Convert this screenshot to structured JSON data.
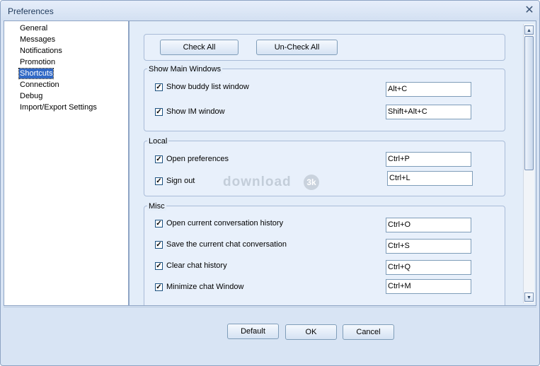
{
  "window": {
    "title": "Preferences"
  },
  "nav": {
    "items": [
      {
        "label": "General"
      },
      {
        "label": "Messages"
      },
      {
        "label": "Notifications"
      },
      {
        "label": "Promotion"
      },
      {
        "label": "Shortcuts",
        "selected": true
      },
      {
        "label": "Connection"
      },
      {
        "label": "Debug"
      },
      {
        "label": "Import/Export Settings"
      }
    ]
  },
  "toolbar": {
    "check_all": "Check All",
    "uncheck_all": "Un-Check All"
  },
  "groups": {
    "main_windows": {
      "title": "Show Main Windows",
      "rows": [
        {
          "label": "Show buddy list window",
          "shortcut": "Alt+C",
          "checked": true
        },
        {
          "label": "Show IM window",
          "shortcut": "Shift+Alt+C",
          "checked": true
        }
      ]
    },
    "local": {
      "title": "Local",
      "rows": [
        {
          "label": "Open preferences",
          "shortcut": "Ctrl+P",
          "checked": true
        },
        {
          "label": "Sign out",
          "shortcut": "Ctrl+L",
          "checked": true
        }
      ]
    },
    "misc": {
      "title": "Misc",
      "rows": [
        {
          "label": "Open current conversation history",
          "shortcut": "Ctrl+O",
          "checked": true
        },
        {
          "label": "Save the current chat conversation",
          "shortcut": "Ctrl+S",
          "checked": true
        },
        {
          "label": "Clear chat history",
          "shortcut": "Ctrl+Q",
          "checked": true
        },
        {
          "label": "Minimize chat Window",
          "shortcut": "Ctrl+M",
          "checked": true
        }
      ]
    }
  },
  "watermark": {
    "text": "download",
    "badge": "3k"
  },
  "footer": {
    "default": "Default",
    "ok": "OK",
    "cancel": "Cancel"
  },
  "icons": {
    "checkmark": "check-icon",
    "close": "close-icon",
    "up": "arrow-up-icon",
    "down": "arrow-down-icon"
  },
  "colors": {
    "selection": "#3169c6",
    "frame": "#d8e4f4",
    "panel": "#e3edf9"
  }
}
